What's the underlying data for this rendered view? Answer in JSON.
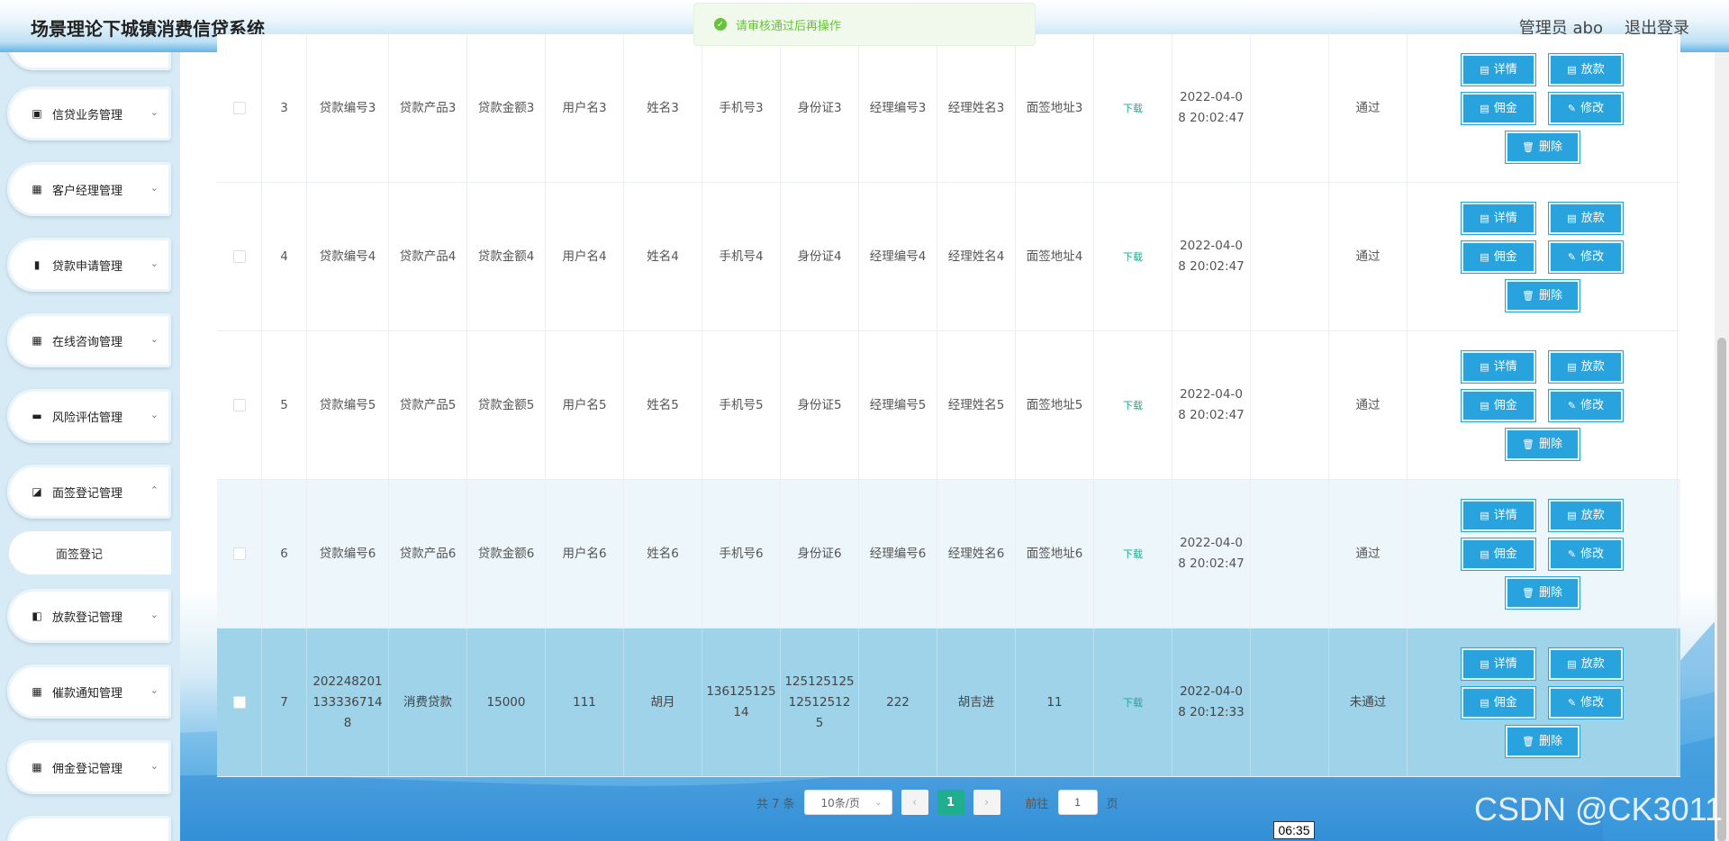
{
  "app": {
    "title": "场景理论下城镇消费信贷系统",
    "user": "管理员 abo",
    "logout": "退出登录"
  },
  "toast": {
    "message": "请审核通过后再操作",
    "icon": "check-circle-icon"
  },
  "sidebar": {
    "items": [
      {
        "label": "信贷业务管理",
        "icon": "clipboard-icon"
      },
      {
        "label": "客户经理管理",
        "icon": "grid-icon"
      },
      {
        "label": "贷款申请管理",
        "icon": "book-icon"
      },
      {
        "label": "在线咨询管理",
        "icon": "grid-icon"
      },
      {
        "label": "风险评估管理",
        "icon": "printer-icon"
      },
      {
        "label": "面签登记管理",
        "icon": "chart-icon"
      },
      {
        "label": "放款登记管理",
        "icon": "wallet-icon"
      },
      {
        "label": "催款通知管理",
        "icon": "grid-icon"
      },
      {
        "label": "佣金登记管理",
        "icon": "grid-icon"
      }
    ],
    "subitem": "面签登记"
  },
  "table": {
    "rows": [
      {
        "idx": "3",
        "loan_no": "贷款编号3",
        "product": "贷款产品3",
        "amount": "贷款金额3",
        "username": "用户名3",
        "name": "姓名3",
        "phone": "手机号3",
        "idcard": "身份证3",
        "mgr_no": "经理编号3",
        "mgr_name": "经理姓名3",
        "address": "面签地址3",
        "file": "下载",
        "time": "2022-04-08 20:02:47",
        "remark": "",
        "status": "通过"
      },
      {
        "idx": "4",
        "loan_no": "贷款编号4",
        "product": "贷款产品4",
        "amount": "贷款金额4",
        "username": "用户名4",
        "name": "姓名4",
        "phone": "手机号4",
        "idcard": "身份证4",
        "mgr_no": "经理编号4",
        "mgr_name": "经理姓名4",
        "address": "面签地址4",
        "file": "下载",
        "time": "2022-04-08 20:02:47",
        "remark": "",
        "status": "通过"
      },
      {
        "idx": "5",
        "loan_no": "贷款编号5",
        "product": "贷款产品5",
        "amount": "贷款金额5",
        "username": "用户名5",
        "name": "姓名5",
        "phone": "手机号5",
        "idcard": "身份证5",
        "mgr_no": "经理编号5",
        "mgr_name": "经理姓名5",
        "address": "面签地址5",
        "file": "下载",
        "time": "2022-04-08 20:02:47",
        "remark": "",
        "status": "通过"
      },
      {
        "idx": "6",
        "loan_no": "贷款编号6",
        "product": "贷款产品6",
        "amount": "贷款金额6",
        "username": "用户名6",
        "name": "姓名6",
        "phone": "手机号6",
        "idcard": "身份证6",
        "mgr_no": "经理编号6",
        "mgr_name": "经理姓名6",
        "address": "面签地址6",
        "file": "下载",
        "time": "2022-04-08 20:02:47",
        "remark": "",
        "status": "通过"
      },
      {
        "idx": "7",
        "loan_no": "2022482011333367148",
        "product": "消费贷款",
        "amount": "15000",
        "username": "111",
        "name": "胡月",
        "phone": "13612512514",
        "idcard": "12512512512512512 5",
        "mgr_no": "222",
        "mgr_name": "胡吉进",
        "address": "11",
        "file": "下载",
        "time": "2022-04-08 20:12:33",
        "remark": "",
        "status": "未通过"
      }
    ],
    "actions": {
      "detail": "详情",
      "release": "放款",
      "commission": "佣金",
      "edit": "修改",
      "delete": "删除"
    }
  },
  "pagination": {
    "total": "共 7 条",
    "page_size": "10条/页",
    "prev": "‹",
    "current": "1",
    "next": "›",
    "goto": "前往",
    "goto_value": "1",
    "page_unit": "页"
  },
  "overlay": {
    "watermark": "CSDN @CK3011",
    "time": "06:35"
  },
  "colors": {
    "accent": "#29a3dd",
    "success": "#67c23a",
    "page_active": "#1fae8e"
  }
}
